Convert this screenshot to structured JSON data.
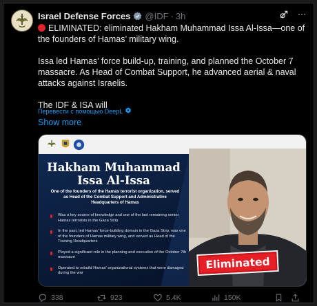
{
  "tweet": {
    "author_name": "Israel Defense Forces",
    "handle": "@IDF",
    "separator": "·",
    "time": "3h",
    "paragraphs": [
      "ELIMINATED: eliminated Hakham Muhammad Issa Al-Issa—one of the founders of Hamas’ military wing.",
      "Issa led Hamas’ force build-up, training, and planned the October 7 massacre. As Head of Combat Support, he advanced aerial & naval attacks against Israelis.",
      "The IDF & ISA will"
    ],
    "translate_label": "Перевести с помощью DeepL",
    "show_more": "Show more"
  },
  "card": {
    "title_line1": "Hakham Muhammad",
    "title_line2": "Issa Al-Issa",
    "subtitle": "One of the founders of the Hamas terrorist organization, served as Head of the Combat Support and Administrative Headquarters of Hamas",
    "bullets": [
      "Was a key source of knowledge and one of the last remaining senior Hamas terrorists in the Gaza Strip",
      "In the past, led Hamas' force-building domain in the Gaza Strip, was one of the founders of Hamas military wing, and served as Head of the Training Headquarters",
      "Played a significant role in the planning and execution of the October 7th massacre",
      "Operated to rebuild Hamas' organizational systems that were damaged during the war"
    ],
    "stamp": "Eliminated"
  },
  "actions": {
    "replies": "338",
    "reposts": "923",
    "likes": "5.4K",
    "views": "150K"
  },
  "icons": [
    "idf-logo-icon",
    "verified-badge-icon",
    "grok-icon",
    "more-options-icon",
    "deepl-icon",
    "reply-icon",
    "repost-icon",
    "like-icon",
    "views-icon",
    "bookmark-icon",
    "share-icon"
  ],
  "colors": {
    "link": "#1d9bf0",
    "muted": "#71767b",
    "alert_red": "#e0242a"
  }
}
